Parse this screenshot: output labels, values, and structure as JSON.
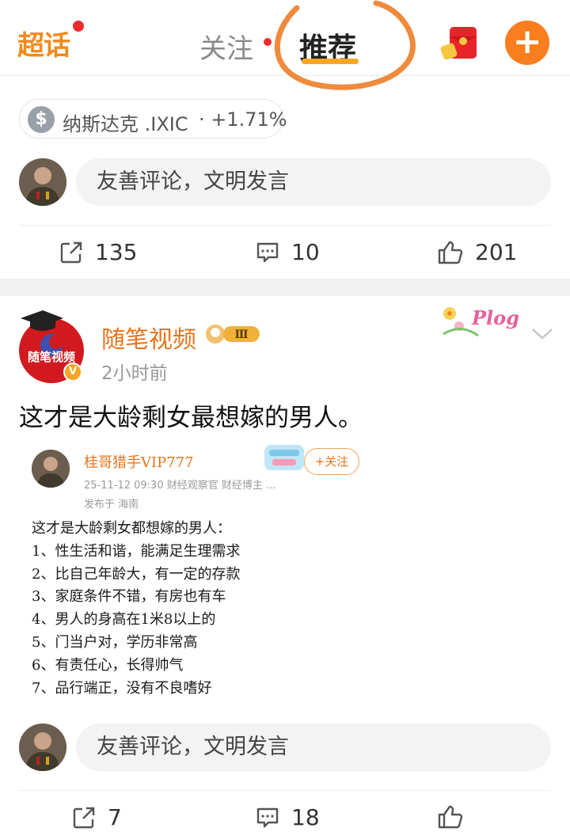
{
  "header": {
    "logo": "超话",
    "tabs": [
      {
        "label": "关注",
        "active": false,
        "has_dot": true
      },
      {
        "label": "推荐",
        "active": true
      }
    ],
    "accent": "#f6a623",
    "plus_glyph": "+"
  },
  "post1": {
    "stock_chip": {
      "icon": "$",
      "name": "纳斯达克 .IXIC",
      "change": "· +1.71%"
    },
    "comment_placeholder": "友善评论，文明发言",
    "actions": {
      "share": "135",
      "comment": "10",
      "like": "201"
    }
  },
  "post2": {
    "author": "随笔视频",
    "avatar_text": "随笔视频",
    "level": "Ⅲ",
    "time": "2小时前",
    "sticker": "Plog",
    "text": "这才是大龄剩女最想嫁的男人。",
    "embed": {
      "author": "桂哥猎手VIP777",
      "meta": "25-11-12 09:30  财经观察官 财经博主 ...",
      "location": "发布于 海南",
      "follow": "+关注",
      "lines": [
        "这才是大龄剩女都想嫁的男人：",
        "1、性生活和谐，能满足生理需求",
        "2、比自己年龄大，有一定的存款",
        "3、家庭条件不错，有房也有车",
        "4、男人的身高在1米8以上的",
        "5、门当户对，学历非常高",
        "6、有责任心，长得帅气",
        "7、品行端正，没有不良嗜好"
      ]
    },
    "comment_placeholder": "友善评论，文明发言",
    "actions": {
      "share": "7",
      "comment": "18"
    }
  }
}
